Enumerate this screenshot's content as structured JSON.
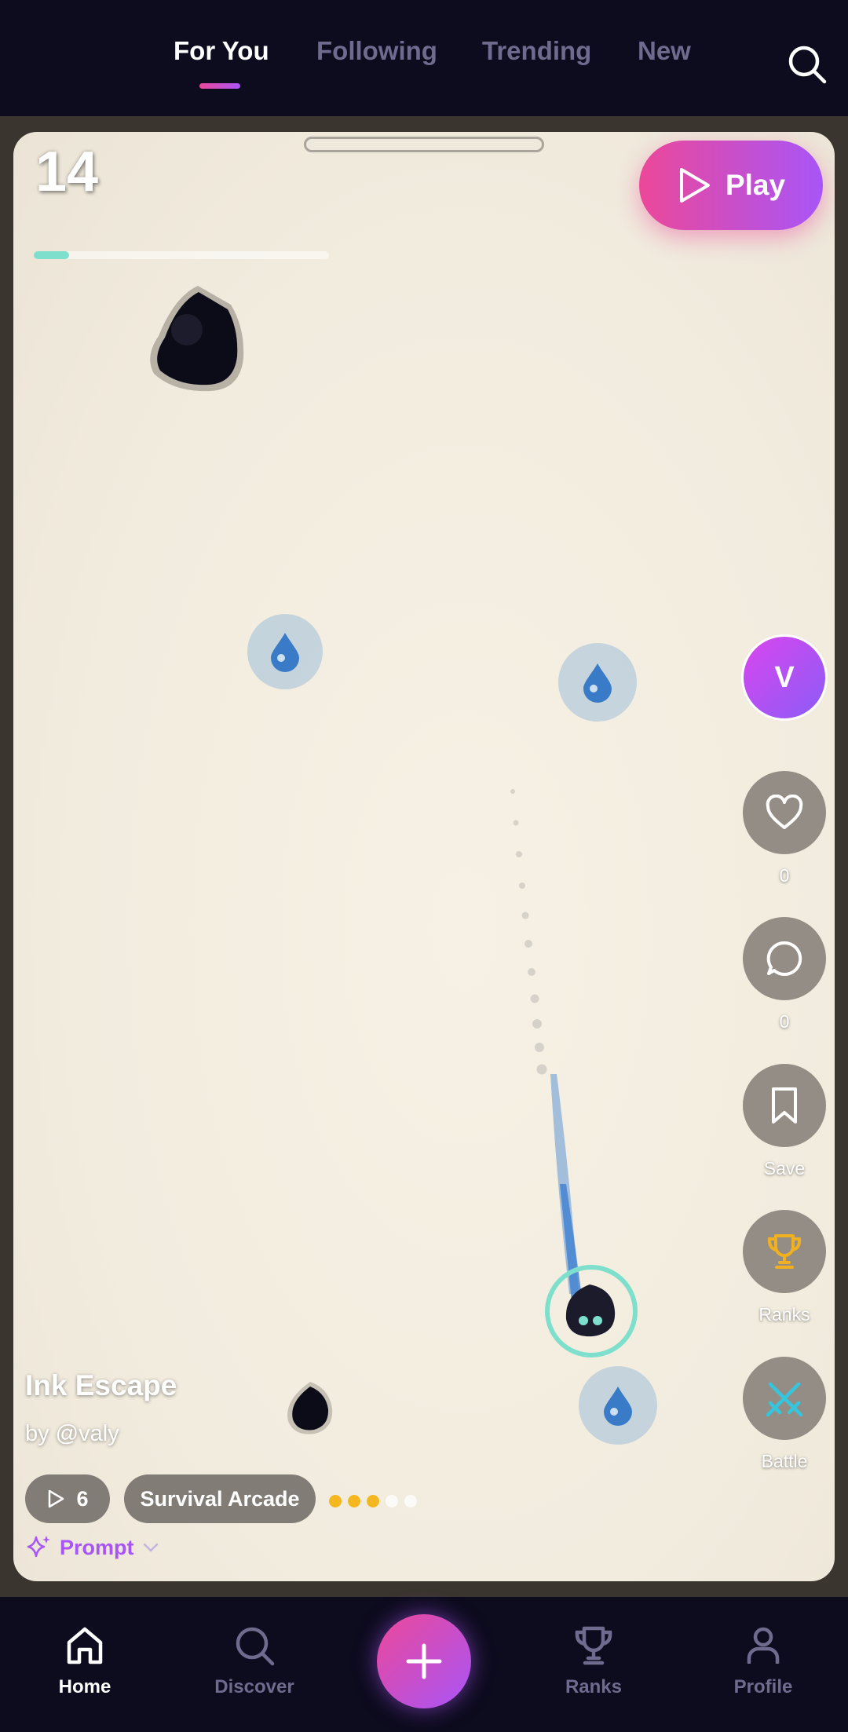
{
  "top_nav": {
    "tabs": [
      {
        "label": "For You"
      },
      {
        "label": "Following"
      },
      {
        "label": "Trending"
      },
      {
        "label": "New"
      }
    ],
    "active_tab": "For You"
  },
  "game": {
    "score": "14",
    "progress_fraction": 0.12,
    "play_label": "Play",
    "title": "Ink Escape",
    "author": "by @valy",
    "play_count": "6",
    "genre": "Survival Arcade",
    "difficulty_level": 3,
    "difficulty_max": 5,
    "prompt_label": "Prompt"
  },
  "creator": {
    "avatar_initial": "V"
  },
  "actions": {
    "like_count": "0",
    "comment_count": "0",
    "save_label": "Save",
    "ranks_label": "Ranks",
    "battle_label": "Battle"
  },
  "bottom_nav": {
    "items": [
      {
        "label": "Home",
        "icon": "home-icon"
      },
      {
        "label": "Discover",
        "icon": "search-icon"
      },
      {
        "label": "Ranks",
        "icon": "trophy-icon"
      },
      {
        "label": "Profile",
        "icon": "user-icon"
      }
    ],
    "active": "Home"
  },
  "colors": {
    "accent_pink": "#ec4899",
    "accent_purple": "#a855f7",
    "nav_background": "#0d0b1e",
    "difficulty_on": "#f5b720",
    "progress": "#7ee0cc",
    "trophy": "#f0b020",
    "battle": "#35c6dd"
  }
}
